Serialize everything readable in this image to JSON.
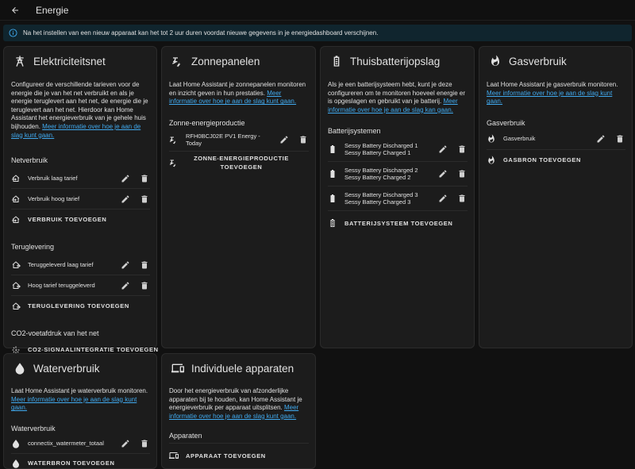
{
  "header": {
    "title": "Energie"
  },
  "alert": {
    "text": "Na het instellen van een nieuw apparaat kan het tot 2 uur duren voordat nieuwe gegevens in je energiedashboard verschijnen."
  },
  "elec": {
    "title": "Elektriciteitsnet",
    "desc": "Configureer de verschillende tarieven voor de energie die je van het net verbruikt en als je energie teruglevert aan het net, de energie die je teruglevert aan het net. Hierdoor kan Home Assistant het energieverbruik van je gehele huis bijhouden.",
    "link": "Meer informatie over hoe je aan de slag kunt gaan.",
    "consumption_heading": "Netverbruik",
    "consumption": [
      "Verbruik laag tarief",
      "Verbruik hoog tarief"
    ],
    "add_consumption": "VERBRUIK TOEVOEGEN",
    "return_heading": "Teruglevering",
    "return": [
      "Teruggeleverd laag tarief",
      "Hoog tarief teruggeleverd"
    ],
    "add_return": "TERUGLEVERING TOEVOEGEN",
    "co2_heading": "CO2-voetafdruk van het net",
    "add_co2": "CO2-SIGNAALINTEGRATIE TOEVOEGEN"
  },
  "solar": {
    "title": "Zonnepanelen",
    "desc": "Laat Home Assistant je zonnepanelen monitoren en inzicht geven in hun prestaties.",
    "link": "Meer informatie over hoe je aan de slag kunt gaan.",
    "heading": "Zonne-energieproductie",
    "items": [
      "RFH0BCJ02E PV1 Energy - Today"
    ],
    "add_line1": "ZONNE-ENERGIEPRODUCTIE",
    "add_line2": "TOEVOEGEN"
  },
  "battery": {
    "title": "Thuisbatterijopslag",
    "desc": "Als je een batterijsysteem hebt, kunt je deze configureren om te monitoren hoeveel energie er is opgeslagen en gebruikt van je batterij.",
    "link": "Meer informatie over hoe je aan de slag kan gaan.",
    "heading": "Batterijsystemen",
    "items": [
      {
        "line1": "Sessy Battery Discharged 1",
        "line2": "Sessy Battery Charged 1"
      },
      {
        "line1": "Sessy Battery Discharged 2",
        "line2": "Sessy Battery Charged 2"
      },
      {
        "line1": "Sessy Battery Discharged 3",
        "line2": "Sessy Battery Charged 3"
      }
    ],
    "add": "BATTERIJSYSTEEM TOEVOEGEN"
  },
  "gas": {
    "title": "Gasverbruik",
    "desc": "Laat Home Assistant je gasverbruik monitoren.",
    "link": "Meer informatie over hoe je aan de slag kunt gaan.",
    "heading": "Gasverbruik",
    "items": [
      "Gasverbruik"
    ],
    "add": "GASBRON TOEVOEGEN"
  },
  "water": {
    "title": "Waterverbruik",
    "desc": "Laat Home Assistant je waterverbruik monitoren.",
    "link": "Meer informatie over hoe je aan de slag kunt gaan.",
    "heading": "Waterverbruik",
    "items": [
      "connectix_watermeter_totaal"
    ],
    "add": "WATERBRON TOEVOEGEN"
  },
  "devices": {
    "title": "Individuele apparaten",
    "desc": "Door het energieverbruik van afzonderlijke apparaten bij te houden, kan Home Assistant je energieverbruik per apparaat uitsplitsen.",
    "link": "Meer informatie over hoe je aan de slag kunt gaan.",
    "heading": "Apparaten",
    "add": "APPARAAT TOEVOEGEN"
  },
  "colors": {
    "accent": "#40a9ee",
    "card": "#1c1c1c",
    "background": "#111111"
  }
}
